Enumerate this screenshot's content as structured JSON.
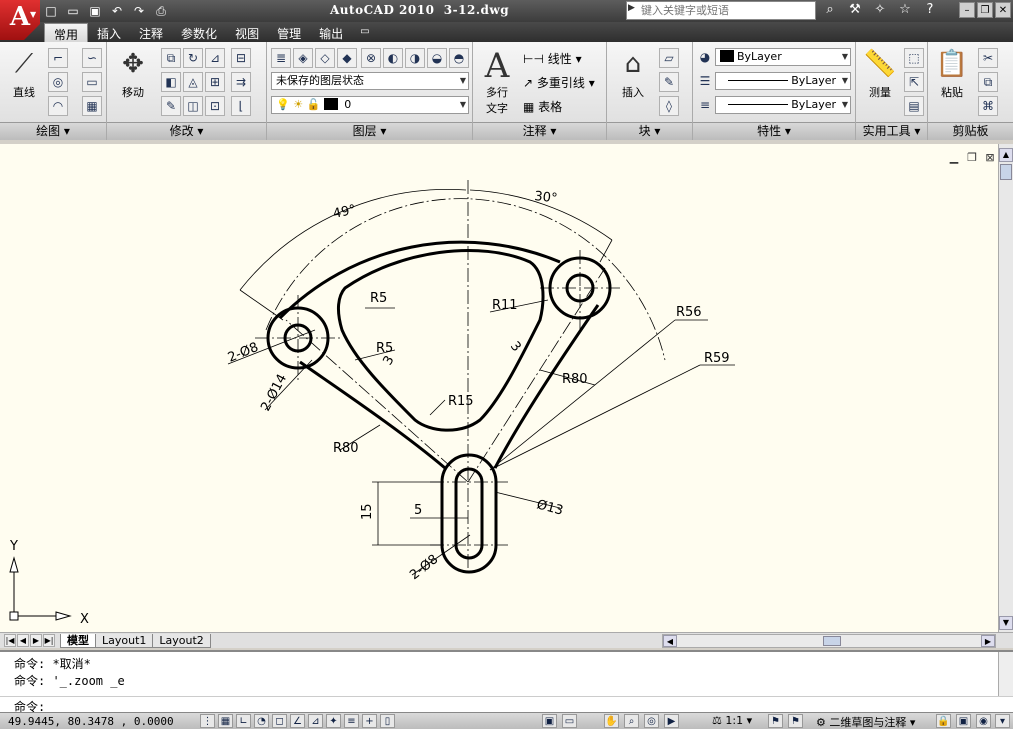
{
  "titlebar": {
    "app_title": "AutoCAD 2010",
    "file_name": "3-12.dwg",
    "search_placeholder": "键入关键字或短语",
    "qat_icons": [
      "new-icon",
      "open-icon",
      "save-icon",
      "undo-icon",
      "redo-icon",
      "plot-icon"
    ]
  },
  "ribbon_tabs": [
    "常用",
    "插入",
    "注释",
    "参数化",
    "视图",
    "管理",
    "输出"
  ],
  "panels": {
    "draw": {
      "title": "绘图",
      "line": "直线"
    },
    "modify": {
      "title": "修改",
      "move": "移动"
    },
    "layers": {
      "title": "图层",
      "layer_state": "未保存的图层状态",
      "current_layer": "0"
    },
    "annotation": {
      "title": "注释",
      "mtext": "多行",
      "mtext2": "文字",
      "linear": "线性",
      "mleader": "多重引线",
      "table": "表格"
    },
    "block": {
      "title": "块",
      "insert": "插入"
    },
    "properties": {
      "title": "特性",
      "color": "ByLayer",
      "linetype": "ByLayer",
      "lineweight": "ByLayer"
    },
    "utilities": {
      "title": "实用工具",
      "measure": "测量"
    },
    "clipboard": {
      "title": "剪贴板",
      "paste": "粘贴"
    }
  },
  "drawing": {
    "angle_left": "49°",
    "angle_right": "30°",
    "dims": [
      "R5",
      "R11",
      "R56",
      "R59",
      "2-Ø8",
      "2-Ø14",
      "R5",
      "3",
      "3",
      "R80",
      "R15",
      "R80",
      "15",
      "5",
      "Ø13",
      "2-Ø8"
    ],
    "ucs_x": "X",
    "ucs_y": "Y"
  },
  "layout_tabs": [
    "模型",
    "Layout1",
    "Layout2"
  ],
  "command": {
    "line1": "命令: *取消*",
    "line2": "命令: '_.zoom _e",
    "prompt": "命令:"
  },
  "status": {
    "coords": "49.9445, 80.3478 , 0.0000",
    "annotation_scale": "1:1",
    "workspace": "二维草图与注释"
  }
}
